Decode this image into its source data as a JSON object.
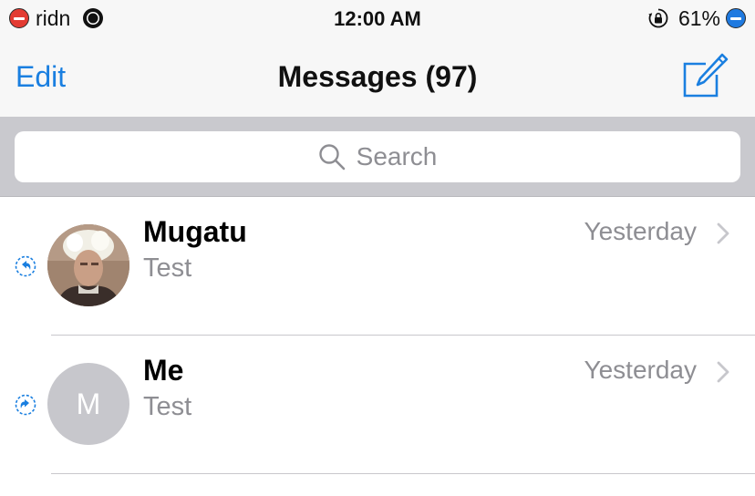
{
  "status_bar": {
    "carrier": "ridn",
    "time": "12:00 AM",
    "battery": "61%"
  },
  "nav": {
    "edit_label": "Edit",
    "title": "Messages (97)",
    "compose_icon": "compose-icon"
  },
  "search": {
    "placeholder": "Search"
  },
  "conversations": [
    {
      "name": "Mugatu",
      "preview": "Test",
      "timestamp": "Yesterday",
      "status_icon": "replied-icon",
      "avatar": "photo"
    },
    {
      "name": "Me",
      "preview": "Test",
      "timestamp": "Yesterday",
      "status_icon": "forwarded-icon",
      "avatar_initial": "M"
    }
  ],
  "colors": {
    "accent": "#1a7fe0",
    "secondary_text": "#8e8e93",
    "search_bar_bg": "#c9c9ce",
    "nav_bg": "#f7f7f7",
    "avatar_placeholder": "#c7c7cc"
  }
}
